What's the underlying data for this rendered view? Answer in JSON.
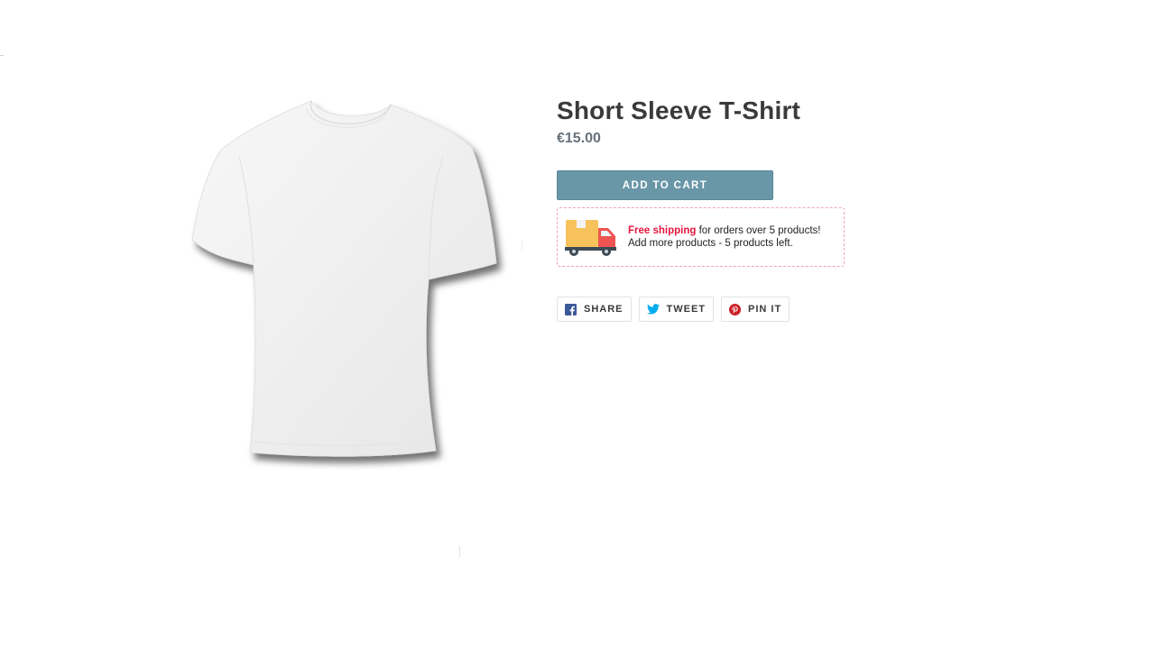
{
  "product": {
    "title": "Short Sleeve T-Shirt",
    "price": "€15.00",
    "add_to_cart_label": "ADD TO CART",
    "image_icon": "white-tshirt-image"
  },
  "shipping": {
    "icon": "delivery-truck-icon",
    "highlight": "Free shipping",
    "line1_rest": " for orders over 5 products!",
    "line2": "Add more products - 5 products left.",
    "highlight_color": "#e5173f"
  },
  "social": {
    "share_label": "SHARE",
    "tweet_label": "TWEET",
    "pin_label": "PIN IT",
    "facebook_color": "#3b5998",
    "twitter_color": "#00aced",
    "pinterest_color": "#cb2027"
  },
  "colors": {
    "button": "#6a97a8",
    "title": "#3a3a3a",
    "price": "#69727b"
  }
}
